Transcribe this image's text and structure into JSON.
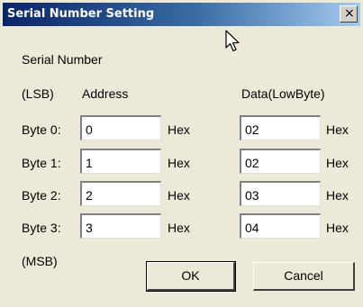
{
  "window": {
    "title": "Serial Number Setting",
    "close_glyph": "×",
    "close_icon": "close-icon"
  },
  "labels": {
    "section": "Serial Number",
    "lsb": "(LSB)",
    "address_header": "Address",
    "data_header": "Data(LowByte)",
    "msb": "(MSB)"
  },
  "rows": [
    {
      "label": "Byte 0:",
      "address": "0",
      "data": "02",
      "unit": "Hex"
    },
    {
      "label": "Byte 1:",
      "address": "1",
      "data": "02",
      "unit": "Hex"
    },
    {
      "label": "Byte 2:",
      "address": "2",
      "data": "03",
      "unit": "Hex"
    },
    {
      "label": "Byte 3:",
      "address": "3",
      "data": "04",
      "unit": "Hex"
    }
  ],
  "buttons": {
    "ok": "OK",
    "cancel": "Cancel"
  },
  "colors": {
    "titlebar_start": "#0a246a",
    "titlebar_end": "#a6caf0",
    "dialog_bg": "#ece9d8"
  }
}
